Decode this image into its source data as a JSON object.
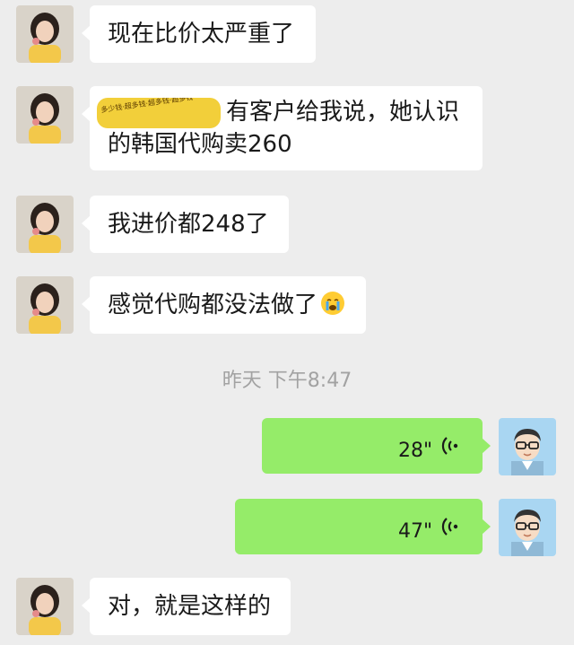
{
  "chat": {
    "messages": [
      {
        "side": "left",
        "text": "现在比价太严重了"
      },
      {
        "side": "left",
        "sticker_text": "多少钱·超多钱·超多钱·超多钱",
        "text_line1": "有客户给我说，她认识",
        "text_line2": "的韩国代购卖260"
      },
      {
        "side": "left",
        "text": "我进价都248了"
      },
      {
        "side": "left",
        "text": "感觉代购都没法做了",
        "emoji": "crying-emoji"
      },
      {
        "side": "right",
        "type": "voice",
        "duration": "28\""
      },
      {
        "side": "right",
        "type": "voice",
        "duration": "47\""
      },
      {
        "side": "left",
        "text": "对，就是这样的"
      }
    ],
    "timestamp": "昨天 下午8:47"
  },
  "colors": {
    "background": "#ededed",
    "left_bubble": "#ffffff",
    "right_bubble": "#95ec69"
  }
}
